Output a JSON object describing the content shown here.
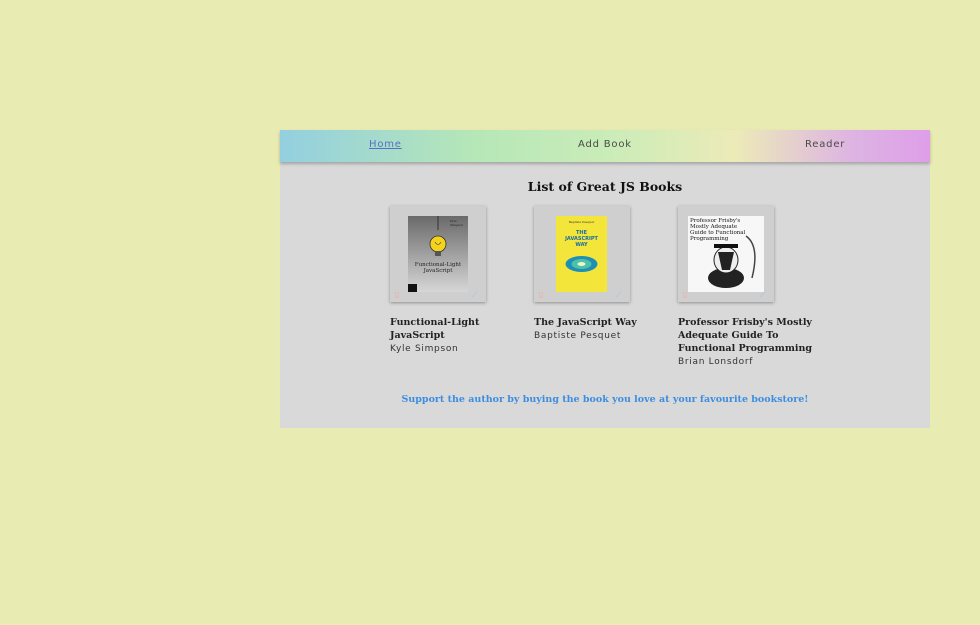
{
  "nav": {
    "home": "Home",
    "add_book": "Add Book",
    "reader": "Reader"
  },
  "page_title": "List of Great JS Books",
  "books": [
    {
      "title": "Functional-Light JavaScript",
      "author": "Kyle Simpson",
      "cover": {
        "author_line": "Kyle Simpson",
        "title_line1": "Functional-Light",
        "title_line2": "JavaScript",
        "icon": "lightbulb-icon"
      }
    },
    {
      "title": "The JavaScript Way",
      "author": "Baptiste Pesquet",
      "cover": {
        "author_line": "Baptiste Pesquet",
        "title_line1": "THE",
        "title_line2": "JAVASCRIPT",
        "title_line3": "WAY",
        "icon": "galaxy-icon"
      }
    },
    {
      "title": "Professor Frisby's Mostly Adequate Guide To Functional Programming",
      "author": "Brian Lonsdorf",
      "cover": {
        "title_text": "Professor Frisby's Mostly Adequate Guide to Functional Programming",
        "icon": "hedgehog-scholar-icon"
      }
    }
  ],
  "footer_text": "Support the author by buying the book you love at your favourite bookstore!",
  "colors": {
    "page_bg": "#e8ebb2",
    "app_bg": "#d9d9d9",
    "link_active": "#5a6fc6",
    "footer_link": "#3d8de0",
    "delete_icon": "#f3a3a3",
    "edit_icon": "#8ec4ef"
  }
}
